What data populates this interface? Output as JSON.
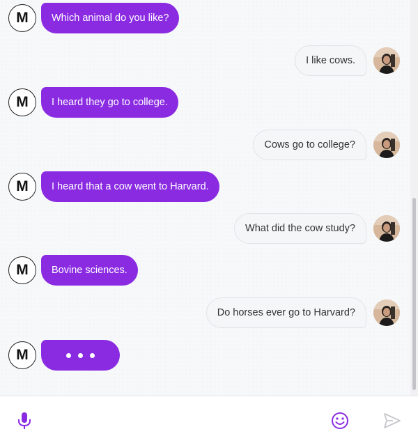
{
  "conversation": [
    {
      "sender": "bot",
      "text": "Which animal do you like?"
    },
    {
      "sender": "user",
      "text": "I like cows."
    },
    {
      "sender": "bot",
      "text": "I heard they go to college."
    },
    {
      "sender": "user",
      "text": "Cows go to college?"
    },
    {
      "sender": "bot",
      "text": "I heard that a cow went to Harvard."
    },
    {
      "sender": "user",
      "text": "What did the cow study?"
    },
    {
      "sender": "bot",
      "text": "Bovine sciences."
    },
    {
      "sender": "user",
      "text": "Do horses ever go to Harvard?"
    }
  ],
  "bot": {
    "avatar_letter": "M",
    "typing": true
  },
  "composer": {
    "value": "",
    "placeholder": ""
  },
  "icons": {
    "mic": "mic-icon",
    "emoji": "emoji-icon",
    "send": "send-icon"
  },
  "colors": {
    "accent": "#8a2be2",
    "user_bubble": "#f5f6f8",
    "send_disabled": "#c8c8cc"
  }
}
